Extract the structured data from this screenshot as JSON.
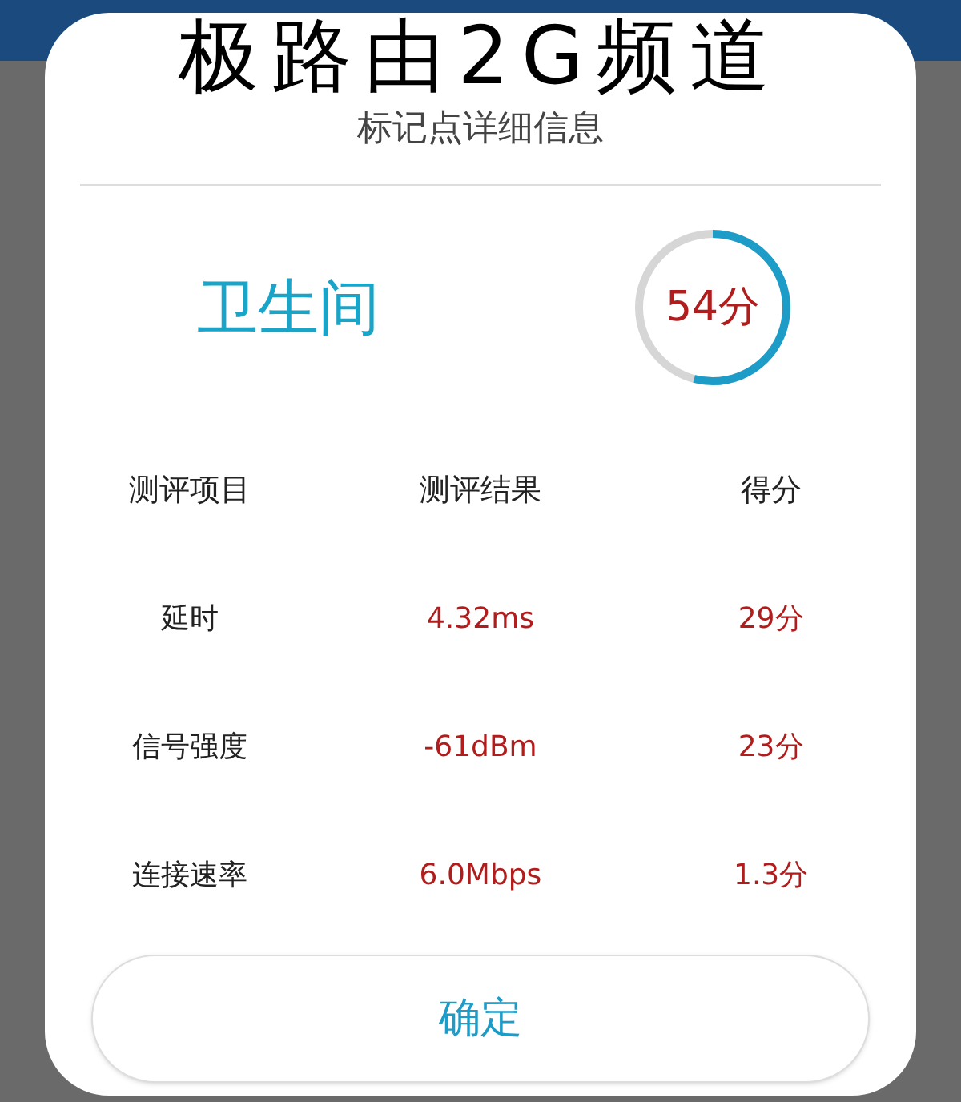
{
  "caption": "极路由2G频道",
  "dialog": {
    "title": "标记点详细信息",
    "location": "卫生间",
    "score": "54分",
    "table": {
      "columns": [
        "测评项目",
        "测评结果",
        "得分"
      ],
      "rows": [
        {
          "item": "延时",
          "result": "4.32ms",
          "score": "29分"
        },
        {
          "item": "信号强度",
          "result": "-61dBm",
          "score": "23分"
        },
        {
          "item": "连接速率",
          "result": "6.0Mbps",
          "score": "1.3分"
        }
      ]
    },
    "button": "确定"
  }
}
